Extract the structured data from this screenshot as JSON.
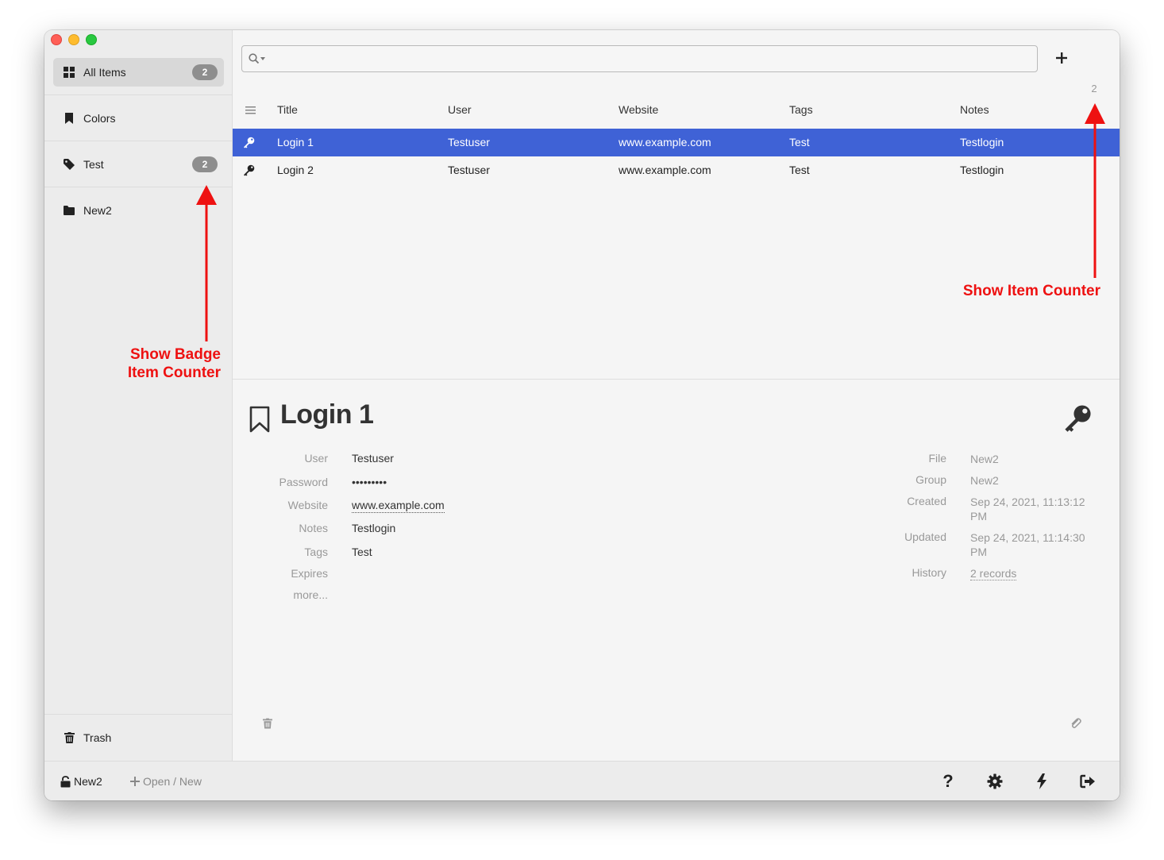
{
  "sidebar": {
    "items": [
      {
        "label": "All Items",
        "badge": "2",
        "icon": "grid-icon"
      },
      {
        "label": "Colors",
        "icon": "bookmark-icon"
      },
      {
        "label": "Test",
        "badge": "2",
        "icon": "tag-icon"
      },
      {
        "label": "New2",
        "icon": "folder-icon"
      }
    ],
    "trash_label": "Trash"
  },
  "search": {
    "value": "",
    "placeholder": ""
  },
  "list": {
    "item_count": "2",
    "columns": [
      "Title",
      "User",
      "Website",
      "Tags",
      "Notes"
    ],
    "rows": [
      {
        "title": "Login 1",
        "user": "Testuser",
        "website": "www.example.com",
        "tags": "Test",
        "notes": "Testlogin",
        "selected": true
      },
      {
        "title": "Login 2",
        "user": "Testuser",
        "website": "www.example.com",
        "tags": "Test",
        "notes": "Testlogin",
        "selected": false
      }
    ]
  },
  "details": {
    "title": "Login 1",
    "fields": [
      {
        "label": "User",
        "value": "Testuser"
      },
      {
        "label": "Password",
        "value": "•••••••••"
      },
      {
        "label": "Website",
        "value": "www.example.com"
      },
      {
        "label": "Notes",
        "value": "Testlogin"
      },
      {
        "label": "Tags",
        "value": "Test"
      },
      {
        "label": "Expires",
        "value": ""
      }
    ],
    "more_label": "more...",
    "meta": [
      {
        "label": "File",
        "value": "New2"
      },
      {
        "label": "Group",
        "value": "New2"
      },
      {
        "label": "Created",
        "value": "Sep 24, 2021, 11:13:12 PM"
      },
      {
        "label": "Updated",
        "value": "Sep 24, 2021, 11:14:30 PM"
      },
      {
        "label": "History",
        "value": "2 records"
      }
    ]
  },
  "footer": {
    "file_name": "New2",
    "open_new_label": "Open / New"
  },
  "annotations": {
    "badge": [
      "Show Badge",
      "Item Counter"
    ],
    "counter": "Show Item Counter"
  },
  "colors": {
    "selection": "#3f62d6",
    "annotation": "#ee1111",
    "badge": "#8e8e8e"
  }
}
